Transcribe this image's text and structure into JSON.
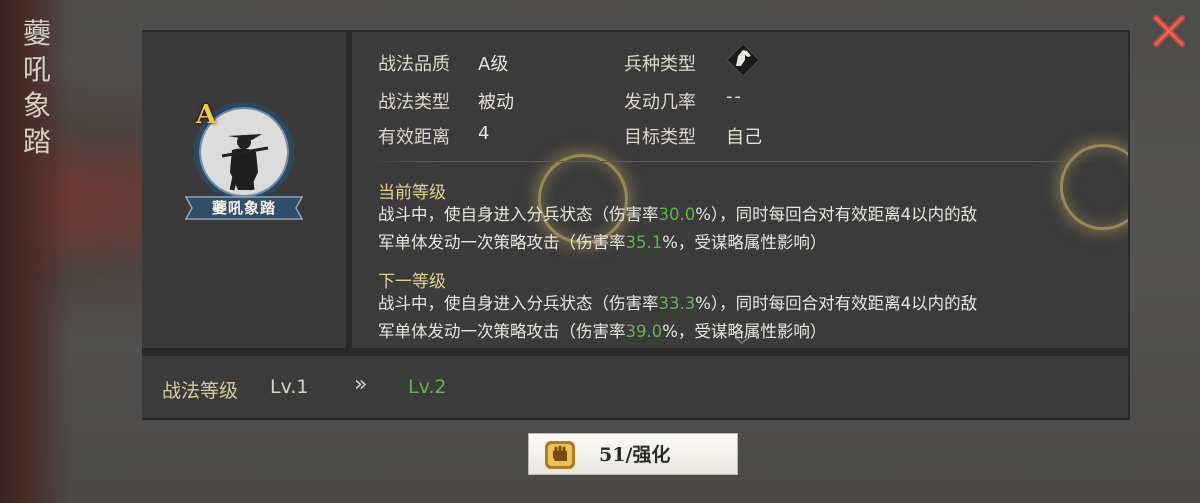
{
  "skill": {
    "title_vertical": "虁吼象踏",
    "name": "虁吼象踏",
    "grade": "A"
  },
  "info": {
    "quality_label": "战法品质",
    "quality_value": "A级",
    "type_label": "战法类型",
    "type_value": "被动",
    "range_label": "有效距离",
    "range_value": "4",
    "troop_label": "兵种类型",
    "trigger_label": "发动几率",
    "trigger_value": "--",
    "target_label": "目标类型",
    "target_value": "自己"
  },
  "current": {
    "title": "当前等级",
    "line1_a": "战斗中，使自身进入分兵状态（伤害率",
    "line1_rate": "30.0",
    "line1_b": "%），同时每回合对有效距离4以内的敌",
    "line2_a": "军单体发动一次策略攻击（伤害率",
    "line2_rate": "35.1",
    "line2_b": "%，受谋略属性影响）"
  },
  "next": {
    "title": "下一等级",
    "line1_a": "战斗中，使自身进入分兵状态（伤害率",
    "line1_rate": "33.3",
    "line1_b": "%），同时每回合对有效距离4以内的敌",
    "line2_a": "军单体发动一次策略攻击（伤害率",
    "line2_rate": "39.0",
    "line2_b": "%，受谋略属性影响）"
  },
  "level": {
    "label": "战法等级",
    "current": "Lv.1",
    "arrow": "»",
    "next": "Lv.2"
  },
  "upgrade": {
    "label": "51/强化"
  },
  "icons": {
    "close": "close-icon",
    "troop_type": "horse-icon",
    "upgrade": "fist-icon"
  },
  "colors": {
    "accent_green": "#62b14f",
    "section_gold": "#e5ce92",
    "close_red": "#c94a3c",
    "grade_gold": "#f1c64a"
  }
}
